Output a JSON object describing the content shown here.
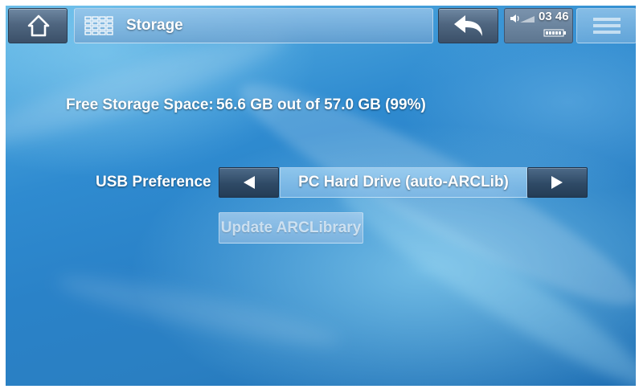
{
  "header": {
    "title": "Storage",
    "icons": {
      "home": "home-icon",
      "app": "grid-icon",
      "back": "back-arrow-icon",
      "volume": "speaker-icon",
      "battery": "battery-icon",
      "menu": "menu-icon"
    },
    "status": {
      "time": "03 46"
    }
  },
  "content": {
    "free_storage_label": "Free Storage Space:",
    "free_storage_value": "56.6 GB out of 57.0 GB (99%)",
    "usb_pref_label": "USB Preference",
    "usb_pref_value": "PC Hard Drive (auto-ARCLib)",
    "update_button_label": "Update ARCLibrary"
  },
  "colors": {
    "bg_primary": "#2f8bd0",
    "button_dark": "#2f4a66",
    "text": "#ffffff"
  }
}
